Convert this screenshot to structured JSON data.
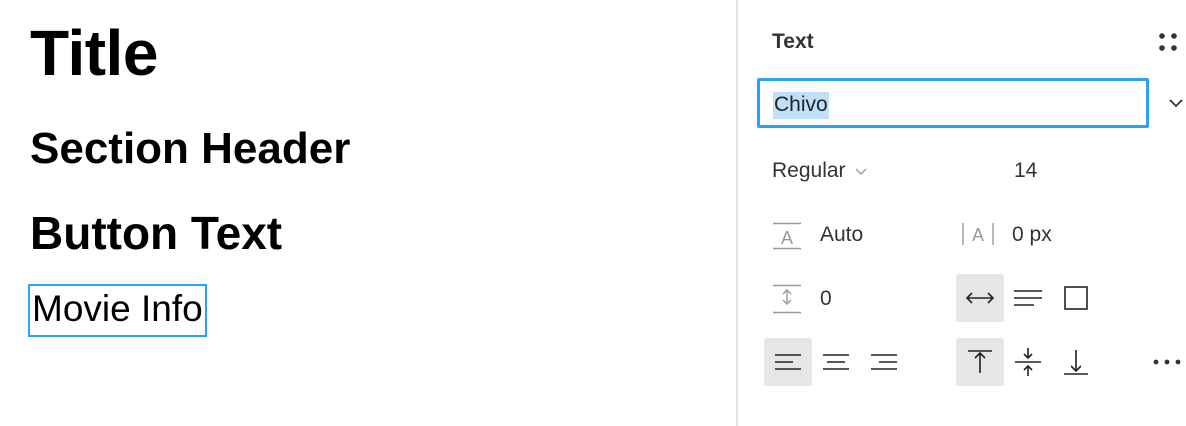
{
  "canvas": {
    "samples": {
      "title": "Title",
      "section_header": "Section Header",
      "button_text": "Button Text",
      "movie_info": "Movie Info"
    },
    "selection_color": "#2ba3f0"
  },
  "panel": {
    "title": "Text",
    "font_family": "Chivo",
    "font_weight": "Regular",
    "font_size": "14",
    "line_height": "Auto",
    "letter_spacing": "0 px",
    "paragraph_spacing": "0",
    "resizing": [
      "auto-width",
      "auto-height",
      "fixed-size"
    ],
    "resizing_selected": "auto-width",
    "align_horizontal": [
      "left",
      "center",
      "right"
    ],
    "align_horizontal_selected": "left",
    "align_vertical": [
      "top",
      "middle",
      "bottom"
    ],
    "align_vertical_selected": "top",
    "icons": [
      "styles-grid-icon",
      "chevron-down-icon",
      "line-height-icon",
      "letter-spacing-icon",
      "paragraph-spacing-icon",
      "more-options-icon"
    ],
    "accent_color": "#2ba3f0",
    "highlight_color": "#bfe0fb"
  }
}
